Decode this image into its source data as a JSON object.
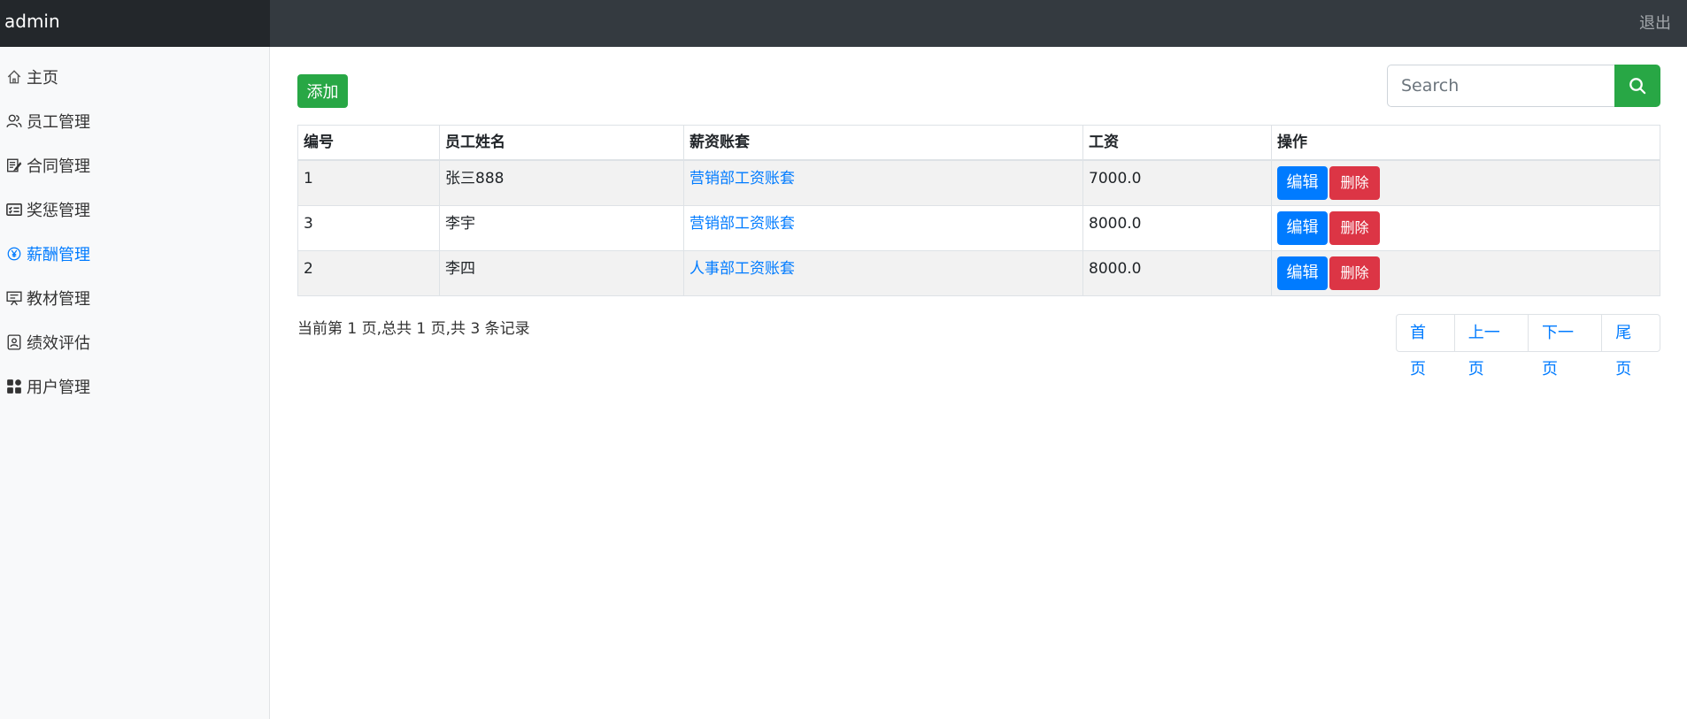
{
  "header": {
    "brand": "admin",
    "logout": "退出"
  },
  "sidebar": {
    "items": [
      {
        "label": "主页",
        "icon": "home-icon"
      },
      {
        "label": "员工管理",
        "icon": "people-icon"
      },
      {
        "label": "合同管理",
        "icon": "contract-edit-icon"
      },
      {
        "label": "奖惩管理",
        "icon": "card-checklist-icon"
      },
      {
        "label": "薪酬管理",
        "icon": "yen-circle-icon",
        "active": true
      },
      {
        "label": "教材管理",
        "icon": "presentation-icon"
      },
      {
        "label": "绩效评估",
        "icon": "file-person-icon"
      },
      {
        "label": "用户管理",
        "icon": "grid-icon"
      }
    ]
  },
  "toolbar": {
    "add_label": "添加",
    "search_placeholder": "Search"
  },
  "table": {
    "headers": [
      "编号",
      "员工姓名",
      "薪资账套",
      "工资",
      "操作"
    ],
    "rows": [
      {
        "id": "1",
        "name": "张三888",
        "account": "营销部工资账套",
        "salary": "7000.0"
      },
      {
        "id": "3",
        "name": "李宇",
        "account": "营销部工资账套",
        "salary": "8000.0"
      },
      {
        "id": "2",
        "name": "李四",
        "account": "人事部工资账套",
        "salary": "8000.0"
      }
    ],
    "edit_label": "编辑",
    "delete_label": "删除"
  },
  "pagination": {
    "info": "当前第 1 页,总共 1 页,共 3 条记录",
    "first": "首页",
    "prev": "上一页",
    "next": "下一页",
    "last": "尾页"
  },
  "colors": {
    "accent": "#007bff",
    "success": "#28a745",
    "danger": "#dc3545",
    "topbar": "#343a40"
  }
}
